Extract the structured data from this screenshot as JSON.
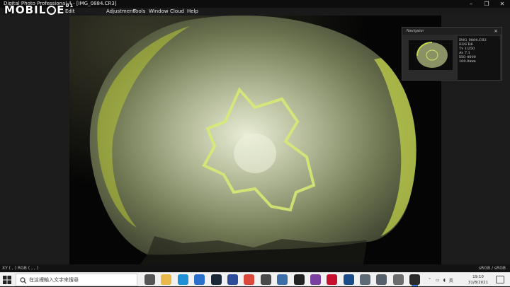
{
  "window": {
    "title": "Digital Photo Professional 4 - [IMG_0884.CR3]",
    "controls": [
      "–",
      "❐",
      "✕"
    ]
  },
  "watermark": {
    "text_left": "MOBIL",
    "text_right": "E",
    "superscript": "01"
  },
  "menu": {
    "items": [
      "Edit",
      "Adjustment",
      "Tools",
      "Window",
      "Cloud",
      "Help"
    ]
  },
  "navigator": {
    "title": "Navigator",
    "close": "×",
    "info": [
      "IMG_0884.CR3",
      "EOS R6",
      "Tv 1/250",
      "Av 7.1",
      "ISO 4000",
      "100.0mm"
    ]
  },
  "status": {
    "left": "XY ( , )     RGB ( , , )",
    "right": "sRGB / sRGB"
  },
  "taskbar": {
    "search_placeholder": "在這裡輸入文字來搜尋",
    "input_method": "英",
    "time": "19:10",
    "date": "31/8/2021",
    "icons": [
      "task-view-icon",
      "file-explorer-icon",
      "edge-icon",
      "mail-icon",
      "steam-icon",
      "store-icon",
      "chrome-icon",
      "pen-tool-icon",
      "browser-icon",
      "terminal-icon",
      "app-icon",
      "canon-icon",
      "eos-utility-icon",
      "device-icon",
      "camera-icon",
      "storage-icon",
      "dpp-icon"
    ],
    "icon_colors": [
      "#555555",
      "#e8b84a",
      "#1f8fd6",
      "#2a6fc9",
      "#1b2838",
      "#2b4d9a",
      "#d9483b",
      "#4a4a4a",
      "#3d6ea8",
      "#222222",
      "#7a3fa0",
      "#c8102e",
      "#1a4c8b",
      "#5f6b74",
      "#55606a",
      "#6d6d6d",
      "#2a2a2a"
    ]
  },
  "colors": {
    "menubar_bg": "#1a1a1a",
    "titlebar_bg": "#0d0d0d",
    "taskbar_bg": "#f1f1f1",
    "accent": "#c8e04a"
  }
}
